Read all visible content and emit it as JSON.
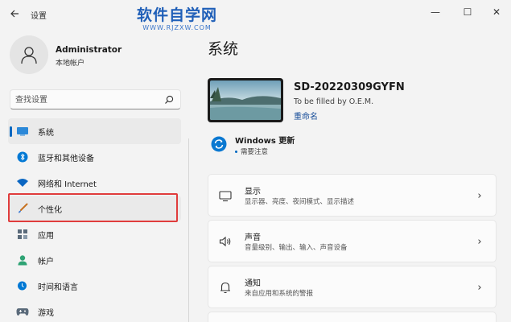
{
  "window": {
    "title": "设置",
    "back_icon": "arrow-left-icon",
    "minimize_glyph": "—",
    "maximize_glyph": "☐",
    "close_glyph": "✕"
  },
  "watermark": {
    "main": "软件自学网",
    "sub": "WWW.RJZXW.COM"
  },
  "profile": {
    "name": "Administrator",
    "account_type": "本地帐户"
  },
  "search": {
    "placeholder": "查找设置"
  },
  "sidebar": {
    "items": [
      {
        "label": "系统",
        "icon": "monitor-icon",
        "color": "#0078d4"
      },
      {
        "label": "蓝牙和其他设备",
        "icon": "bluetooth-icon",
        "color": "#0078d4"
      },
      {
        "label": "网络和 Internet",
        "icon": "wifi-icon",
        "color": "#0a66c2"
      },
      {
        "label": "个性化",
        "icon": "paintbrush-icon",
        "color": "#e3823a"
      },
      {
        "label": "应用",
        "icon": "apps-icon",
        "color": "#5a6a7a"
      },
      {
        "label": "帐户",
        "icon": "person-icon",
        "color": "#2fa374"
      },
      {
        "label": "时间和语言",
        "icon": "globe-clock-icon",
        "color": "#0078d4"
      },
      {
        "label": "游戏",
        "icon": "gamepad-icon",
        "color": "#5a6a7a"
      }
    ],
    "active_index": 0,
    "highlight_index": 3,
    "highlight_color": "#e03c3c"
  },
  "main": {
    "title": "系统",
    "device": {
      "name": "SD-20220309GYFN",
      "model": "To be filled by O.E.M.",
      "rename_label": "重命名"
    },
    "update": {
      "title": "Windows 更新",
      "status": "需要注意"
    },
    "cards": [
      {
        "title": "显示",
        "desc": "显示器、亮度、夜间模式、显示描述",
        "icon": "display-icon"
      },
      {
        "title": "声音",
        "desc": "音量级别、输出、输入、声音设备",
        "icon": "speaker-icon"
      },
      {
        "title": "通知",
        "desc": "来自应用和系统的警报",
        "icon": "bell-icon"
      }
    ],
    "chevron_glyph": "›"
  },
  "colors": {
    "accent": "#0067c0",
    "background": "#f3f3f3",
    "card": "#fbfbfb"
  }
}
